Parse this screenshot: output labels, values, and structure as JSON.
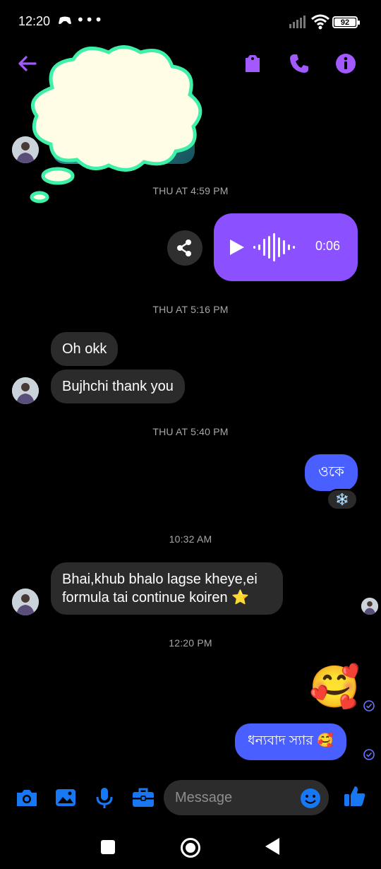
{
  "status_bar": {
    "time": "12:20",
    "more": "•••",
    "battery": "92"
  },
  "header": {
    "back_icon": "arrow-left-icon",
    "icons": [
      "tag-icon",
      "phone-icon",
      "info-icon"
    ],
    "accent": "#a259ff"
  },
  "messages": {
    "ts1": "THU AT 4:59 PM",
    "voice_duration": "0:06",
    "ts2": "THU AT 5:16 PM",
    "in1": "Oh okk",
    "in2": "Bujhchi thank you",
    "ts3": "THU AT 5:40 PM",
    "out1": "ওকে",
    "reaction": "❄️",
    "ts4": "10:32 AM",
    "in3_line1": "Bhai,khub bhalo lagse kheye,ei",
    "in3_line2": "formula tai continue koiren ⭐",
    "ts5": "12:20 PM",
    "out_emoji": "🥰",
    "out2": "ধন্যবাদ স্যার 🥰"
  },
  "composer": {
    "placeholder": "Message",
    "icons": [
      "camera-icon",
      "image-icon",
      "mic-icon",
      "briefcase-icon",
      "emoji-icon",
      "thumbs-up-icon"
    ],
    "accent": "#1877f2"
  },
  "colors": {
    "incoming_bubble": "#2b2b2b",
    "outgoing_bubble": "#4a5fff",
    "voice_bubble": "#8b50ff"
  }
}
